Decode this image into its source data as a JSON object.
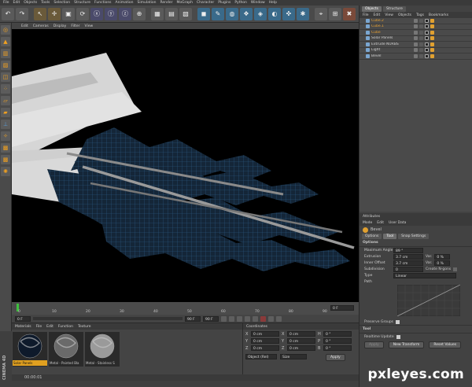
{
  "menubar": [
    "File",
    "Edit",
    "Objects",
    "Tools",
    "Selection",
    "Structure",
    "Functions",
    "Animation",
    "Simulation",
    "Render",
    "MoGraph",
    "Character",
    "Plugins",
    "Python",
    "Window",
    "Help"
  ],
  "viewport_menu": [
    "Edit",
    "Cameras",
    "Display",
    "Filter",
    "View"
  ],
  "timeline": {
    "ticks": [
      "0",
      "10",
      "20",
      "30",
      "40",
      "50",
      "60",
      "70",
      "80",
      "90"
    ],
    "end_frame": "0 F",
    "start_field": "0 F",
    "max_field": "90 F",
    "max_field2": "90 F"
  },
  "materials": {
    "menu": [
      "Materials",
      "File",
      "Edit",
      "Function",
      "Texture"
    ],
    "items": [
      {
        "label": "Solar Panels",
        "color": "#0e1a2b",
        "selected": true
      },
      {
        "label": "Metal - Painted Bla",
        "color": "#6a6a6a",
        "selected": false
      },
      {
        "label": "Metal - Stainless S",
        "color": "#9a9a9a",
        "selected": false
      }
    ]
  },
  "coordinates": {
    "title": "Coordinates",
    "rows": [
      {
        "a": "X",
        "av": "0 cm",
        "b": "X",
        "bv": "0 cm",
        "c": "H",
        "cv": "0 °"
      },
      {
        "a": "Y",
        "av": "0 cm",
        "b": "Y",
        "bv": "0 cm",
        "c": "P",
        "cv": "0 °"
      },
      {
        "a": "Z",
        "av": "0 cm",
        "b": "Z",
        "bv": "0 cm",
        "c": "B",
        "cv": "0 °"
      }
    ],
    "mode": "Object (Rel)",
    "size_mode": "Size",
    "apply": "Apply"
  },
  "statusbar": {
    "time": "00:00:01"
  },
  "brand": "CINEMA 4D",
  "object_panel": {
    "tabs": [
      "Objects",
      "Structure"
    ],
    "menu": [
      "File",
      "Edit",
      "View",
      "Objects",
      "Tags",
      "Bookmarks"
    ],
    "objects": [
      {
        "name": "Cube.2",
        "indent": 0,
        "color": "#e8a030"
      },
      {
        "name": "Cube.1",
        "indent": 0,
        "color": "#e8a030"
      },
      {
        "name": "Cube",
        "indent": 0,
        "color": "#e8a030"
      },
      {
        "name": "Solar Panels",
        "indent": 0,
        "color": "#cfcfcf"
      },
      {
        "name": "Extrude NURBS",
        "indent": 0,
        "color": "#cfcfcf"
      },
      {
        "name": "Light",
        "indent": 0,
        "color": "#cfcfcf"
      },
      {
        "name": "Bevel",
        "indent": 0,
        "color": "#cfcfcf"
      }
    ]
  },
  "attributes": {
    "title": "Attributes",
    "menu": [
      "Mode",
      "Edit",
      "User Data"
    ],
    "object_name": "Bevel",
    "tabs": [
      "Options",
      "Tool",
      "Snap Settings"
    ],
    "section": "Options",
    "rows": [
      {
        "label": "Maximum Angle",
        "value": "89 °"
      },
      {
        "label": "Extrusion",
        "value": "3.7 cm",
        "extra_label": "Var.",
        "extra_value": "0 %"
      },
      {
        "label": "Inner Offset",
        "value": "3.7 cm",
        "extra_label": "Var.",
        "extra_value": "0 %"
      },
      {
        "label": "Subdivision",
        "value": "0",
        "extra_label": "Create N-gons",
        "extra_value": ""
      }
    ],
    "type_label": "Type",
    "type_value": "Linear",
    "path_label": "Path",
    "preserve_groups": "Preserve Groups",
    "tool_section": "Tool",
    "realtime_update": "Realtime Update",
    "buttons": [
      "Apply",
      "New Transform",
      "Reset Values"
    ]
  },
  "watermark": "pxleyes.com"
}
